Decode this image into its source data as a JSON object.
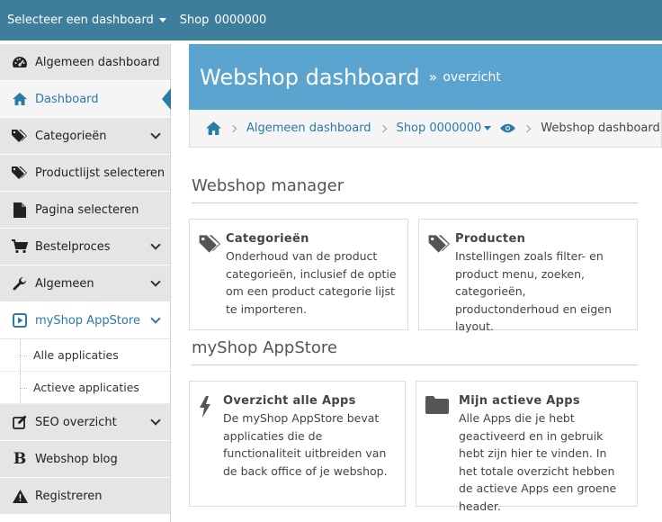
{
  "topbar": {
    "dashboard_select": "Selecteer een dashboard",
    "shop_label": "Shop",
    "shop_number": "0000000"
  },
  "sidebar": {
    "items": [
      {
        "label": "Algemeen dashboard",
        "icon": "dashboard-icon"
      },
      {
        "label": "Dashboard",
        "icon": "home-icon"
      },
      {
        "label": "Categorieën",
        "icon": "tags-icon"
      },
      {
        "label": "Productlijst selecteren",
        "icon": "tags-icon"
      },
      {
        "label": "Pagina selecteren",
        "icon": "file-icon"
      },
      {
        "label": "Bestelproces",
        "icon": "cart-icon"
      },
      {
        "label": "Algemeen",
        "icon": "wrench-icon"
      },
      {
        "label": "myShop AppStore",
        "icon": "play-square-icon"
      },
      {
        "label": "SEO overzicht",
        "icon": "edit-icon"
      },
      {
        "label": "Webshop blog",
        "icon": "bold-b-icon"
      },
      {
        "label": "Registreren",
        "icon": "warning-icon"
      }
    ],
    "subitems": [
      "Alle applicaties",
      "Actieve applicaties"
    ]
  },
  "header": {
    "title": "Webshop dashboard",
    "separator": "»",
    "subtitle": "overzicht"
  },
  "breadcrumb": {
    "crumb1": "Algemeen dashboard",
    "crumb2": "Shop 0000000",
    "current": "Webshop dashboard"
  },
  "sections": {
    "manager_title": "Webshop manager",
    "appstore_title": "myShop AppStore"
  },
  "cards": {
    "categories": {
      "title": "Categorieën",
      "desc": "Onderhoud van de product categorieën, inclusief de optie om een product categorie lijst te importeren."
    },
    "products": {
      "title": "Producten",
      "desc": "Instellingen zoals filter- en product menu, zoeken, categorieën, productonderhoud en eigen layout."
    },
    "all_apps": {
      "title": "Overzicht alle Apps",
      "desc": "De myShop AppStore bevat applicaties die de functionaliteit uitbreiden van de back office of je webshop."
    },
    "active_apps": {
      "title": "Mijn actieve Apps",
      "desc": "Alle Apps die je hebt geactiveerd en in gebruik hebt zijn hier te vinden. In het totale overzicht hebben de actieve Apps een groene header."
    }
  },
  "colors": {
    "topbar": "#3d7e9c",
    "header_band": "#5aa4cf",
    "link": "#2b7aa8",
    "sidebar_bg": "#e5e5e5"
  }
}
